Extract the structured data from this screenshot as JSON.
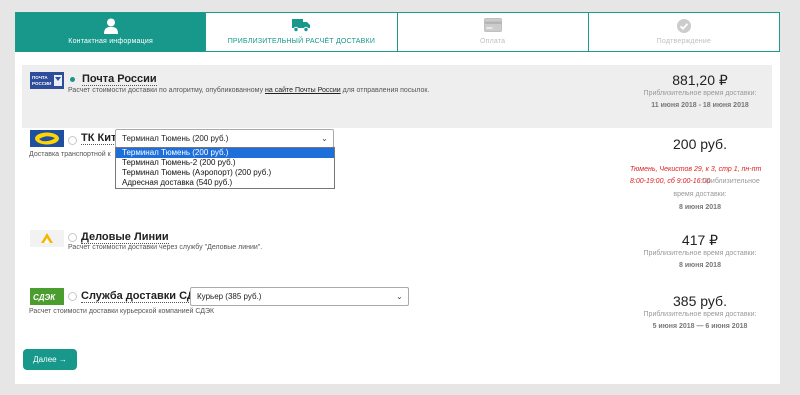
{
  "steps": [
    {
      "label": "Контактная информация",
      "icon": "user-icon"
    },
    {
      "label": "ПРИБЛИЗИТЕЛЬНЫЙ РАСЧЁТ ДОСТАВКИ",
      "icon": "truck-icon"
    },
    {
      "label": "Оплата",
      "icon": "card-icon"
    },
    {
      "label": "Подтверждение",
      "icon": "check-icon"
    }
  ],
  "pochta": {
    "logo_text": "ПОЧТА РОССИИ",
    "name": "Почта России",
    "desc_before": "Расчет стоимости доставки по алгоритму, опубликованному ",
    "desc_link": "на сайте Почты России",
    "desc_after": " для отправления посылок.",
    "price": "881,20 ₽",
    "note": "Приблизительное время доставки:",
    "date": "11 июня 2018 - 18 июня 2018"
  },
  "kit": {
    "name": "ТК Кит",
    "desc": "Доставка транспортной к",
    "select_value": "Терминал Тюмень (200 руб.)",
    "options": [
      "Терминал Тюмень (200 руб.)",
      "Терминал Тюмень-2 (200 руб.)",
      "Терминал Тюмень (Аэропорт) (200 руб.)",
      "Адресная доставка (540 руб.)"
    ],
    "price": "200 руб.",
    "addr_line1": "Тюмень, Чекистов 29, к 3, стр 1, пн-пт",
    "addr_line2": "8:00-19:00, сб 9:00-16:00",
    "note_inline": "Приблизительное",
    "note": "время доставки:",
    "date": "8 июня 2018"
  },
  "dl": {
    "name": "Деловые Линии",
    "desc": "Расчет стоимости доставки через службу \"Деловые линии\".",
    "price": "417 ₽",
    "note": "Приблизительное время доставки:",
    "date": "8 июня 2018"
  },
  "cdek": {
    "logo_text": "СДЭК",
    "name": "Служба доставки СДЭК",
    "desc": "Расчет стоимости доставки курьерской компанией СДЭК",
    "select_value": "Курьер (385 руб.)",
    "price": "385 руб.",
    "note": "Приблизительное время доставки:",
    "date": "5 июня 2018 — 6 июня 2018"
  },
  "next_label": "Далее →"
}
